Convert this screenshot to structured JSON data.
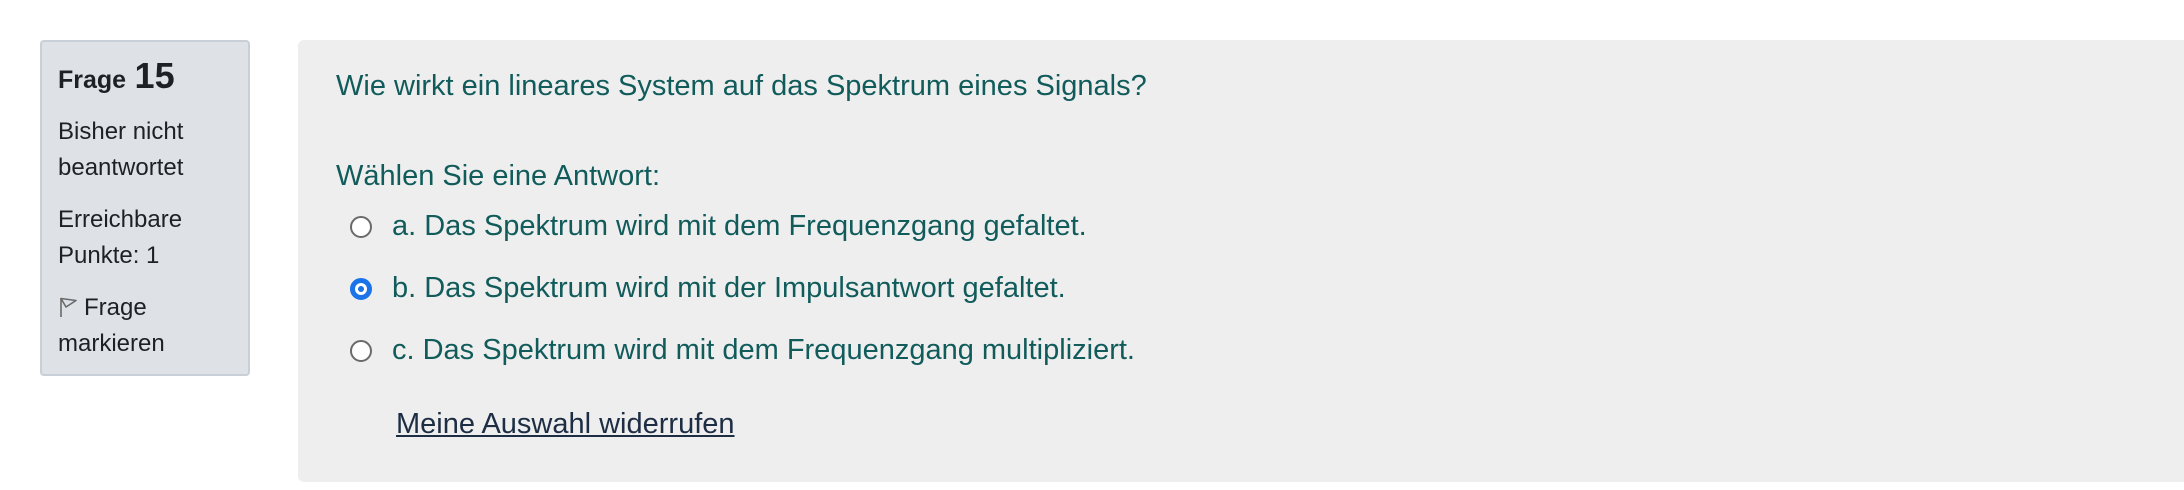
{
  "info": {
    "question_word": "Frage",
    "question_number": "15",
    "state_line1": "Bisher nicht",
    "state_line2": "beantwortet",
    "grade_line1": "Erreichbare",
    "grade_line2": "Punkte: 1",
    "flag_line1": "Frage",
    "flag_line2": "markieren",
    "flag_icon": "flag-outline-icon"
  },
  "question": {
    "text": "Wie wirkt ein lineares System auf das Spektrum eines Signals?",
    "prompt": "Wählen Sie eine Antwort:",
    "answers": [
      {
        "label": "a. Das Spektrum wird mit dem Frequenzgang gefaltet.",
        "selected": false
      },
      {
        "label": "b. Das Spektrum wird mit der Impulsantwort gefaltet.",
        "selected": true
      },
      {
        "label": "c. Das Spektrum wird mit dem Frequenzgang multipliziert.",
        "selected": false
      }
    ],
    "clear_choice": "Meine Auswahl widerrufen"
  },
  "colors": {
    "info_background": "#dee2e6",
    "content_background": "#eeeeee",
    "question_text": "#115b5b",
    "radio_selected": "#1a73e8",
    "link": "#1d2d44"
  }
}
